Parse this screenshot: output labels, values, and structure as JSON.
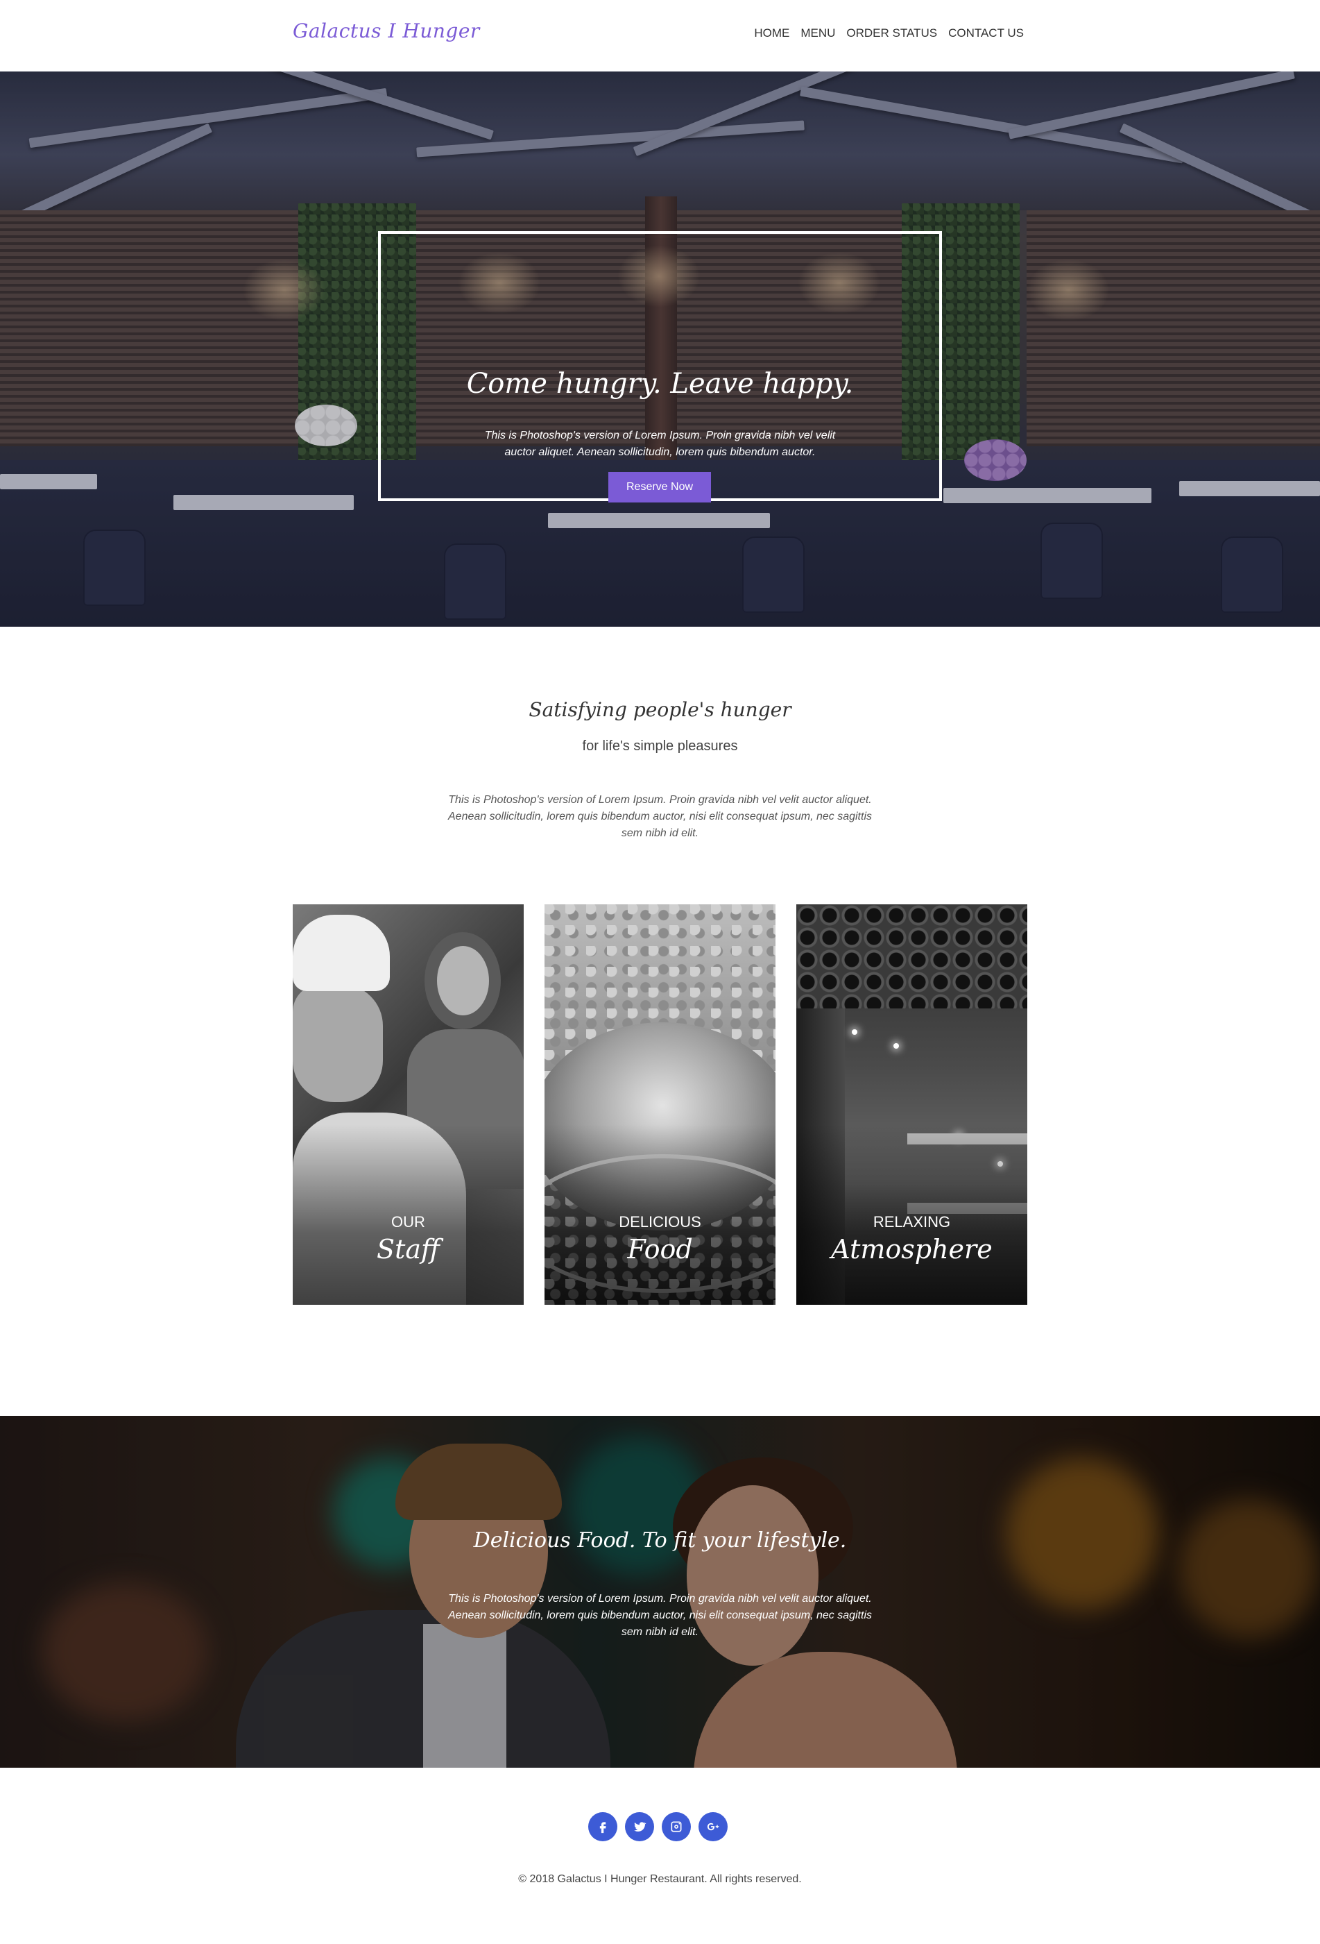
{
  "header": {
    "brand": "Galactus I Hunger",
    "nav": [
      "HOME",
      "MENU",
      "ORDER STATUS",
      "CONTACT US"
    ]
  },
  "hero": {
    "title": "Come hungry. Leave happy.",
    "text": "This is Photoshop's version of Lorem Ipsum. Proin gravida nibh vel velit auctor aliquet. Aenean sollicitudin, lorem quis bibendum auctor.",
    "button_label": "Reserve Now"
  },
  "intro": {
    "title": "Satisfying people's hunger",
    "subtitle": "for life's simple pleasures",
    "text": "This is Photoshop's version of Lorem Ipsum. Proin gravida nibh vel velit auctor aliquet. Aenean sollicitudin, lorem quis bibendum auctor, nisi elit consequat ipsum, nec sagittis sem nibh id elit."
  },
  "cards": [
    {
      "top": "OUR",
      "bottom": "Staff"
    },
    {
      "top": "DELICIOUS",
      "bottom": "Food"
    },
    {
      "top": "RELAXING",
      "bottom": "Atmosphere"
    }
  ],
  "banner": {
    "title": "Delicious Food. To fit your lifestyle.",
    "text": "This is Photoshop's version of Lorem Ipsum. Proin gravida nibh vel velit auctor aliquet. Aenean sollicitudin, lorem quis bibendum auctor, nisi elit consequat ipsum, nec sagittis sem nibh id elit."
  },
  "footer": {
    "socials": [
      "facebook-icon",
      "twitter-icon",
      "instagram-icon",
      "google-plus-icon"
    ],
    "copyright": "© 2018 Galactus I Hunger Restaurant. All rights reserved."
  },
  "colors": {
    "accent": "#7b5bd6",
    "social": "#3d5bd6"
  }
}
